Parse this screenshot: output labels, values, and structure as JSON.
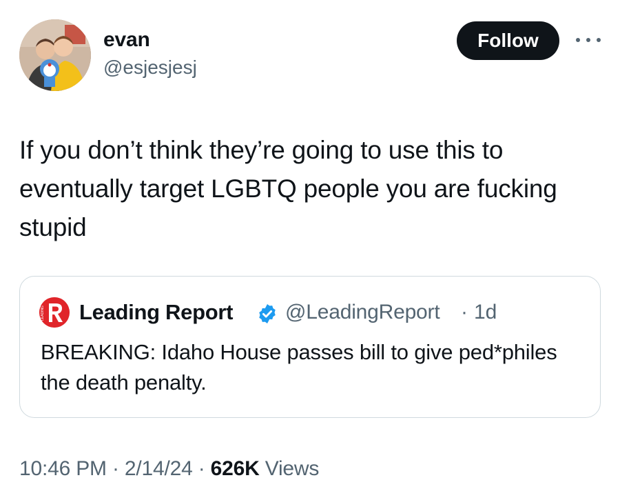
{
  "author": {
    "display_name": "evan",
    "handle": "@esjesjesj",
    "avatar_icon": "profile-photo"
  },
  "actions": {
    "follow_label": "Follow",
    "more_icon": "more-horizontal-icon"
  },
  "tweet": {
    "text": "If you don’t think they’re going to use this to eventually target LGBTQ people you are fucking stupid"
  },
  "quoted": {
    "logo_icon": "leading-report-logo",
    "display_name": "Leading Report",
    "verified_icon": "verified-badge-icon",
    "handle": "@LeadingReport",
    "separator": "·",
    "time": "1d",
    "text": "BREAKING: Idaho House passes bill to give ped*philes the death penalty."
  },
  "meta": {
    "time": "10:46 PM",
    "sep1": " · ",
    "date": "2/14/24",
    "sep2": " · ",
    "views_count": "626K",
    "views_label": " Views"
  },
  "colors": {
    "text_primary": "#0f1419",
    "text_secondary": "#536471",
    "border": "#cfd9de",
    "follow_bg": "#0f1419",
    "verified": "#1d9bf0",
    "logo_red": "#e0252a"
  }
}
